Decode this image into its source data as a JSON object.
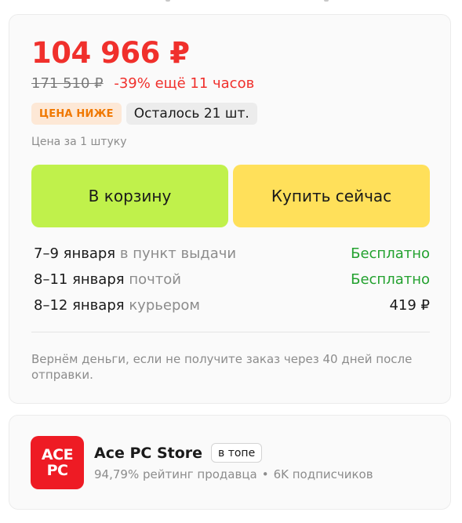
{
  "price": {
    "current": "104 966 ₽",
    "old": "171 510 ₽",
    "discount_text": "-39% ещё 11 часов"
  },
  "badges": {
    "lower_price": "ЦЕНА НИЖЕ",
    "stock": "Осталось 21 шт."
  },
  "unit_note": "Цена за 1 штуку",
  "buttons": {
    "cart": "В корзину",
    "buy_now": "Купить сейчас"
  },
  "delivery": [
    {
      "dates": "7–9 января",
      "method": "в пункт выдачи",
      "cost": "Бесплатно"
    },
    {
      "dates": "8–11 января",
      "method": "почтой",
      "cost": "Бесплатно"
    },
    {
      "dates": "8–12 января",
      "method": "курьером",
      "cost": "419 ₽"
    }
  ],
  "refund_note": "Вернём деньги, если не получите заказ через 40 дней после отправки.",
  "seller": {
    "logo_line1": "ACE",
    "logo_line2": "PC",
    "name": "Ace PC Store",
    "top_badge": "в топе",
    "rating": "94,79% рейтинг продавца",
    "separator": "•",
    "subscribers": "6K подписчиков"
  },
  "colors": {
    "price_red": "#f0302c",
    "free_green": "#23a12f",
    "cart_button": "#c0f14b",
    "buy_button": "#ffe05a",
    "logo_red": "#ee1b24"
  }
}
